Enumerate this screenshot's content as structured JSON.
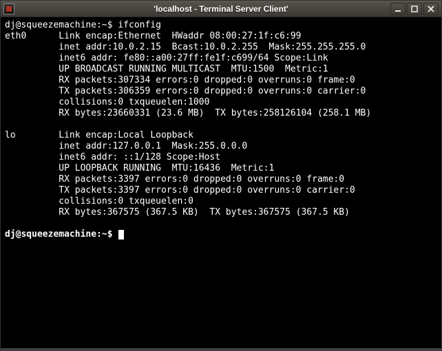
{
  "window": {
    "title": "'localhost - Terminal Server Client'"
  },
  "prompt1": {
    "user_host": "dj@squeezemachine",
    "path": "~",
    "command": "ifconfig"
  },
  "interfaces": [
    {
      "name": "eth0",
      "lines": [
        "Link encap:Ethernet  HWaddr 08:00:27:1f:c6:99",
        "inet addr:10.0.2.15  Bcast:10.0.2.255  Mask:255.255.255.0",
        "inet6 addr: fe80::a00:27ff:fe1f:c699/64 Scope:Link",
        "UP BROADCAST RUNNING MULTICAST  MTU:1500  Metric:1",
        "RX packets:307334 errors:0 dropped:0 overruns:0 frame:0",
        "TX packets:306359 errors:0 dropped:0 overruns:0 carrier:0",
        "collisions:0 txqueuelen:1000",
        "RX bytes:23660331 (23.6 MB)  TX bytes:258126104 (258.1 MB)"
      ]
    },
    {
      "name": "lo",
      "lines": [
        "Link encap:Local Loopback",
        "inet addr:127.0.0.1  Mask:255.0.0.0",
        "inet6 addr: ::1/128 Scope:Host",
        "UP LOOPBACK RUNNING  MTU:16436  Metric:1",
        "RX packets:3397 errors:0 dropped:0 overruns:0 frame:0",
        "TX packets:3397 errors:0 dropped:0 overruns:0 carrier:0",
        "collisions:0 txqueuelen:0",
        "RX bytes:367575 (367.5 KB)  TX bytes:367575 (367.5 KB)"
      ]
    }
  ],
  "prompt2": {
    "user_host": "dj@squeezemachine",
    "path": "~"
  }
}
